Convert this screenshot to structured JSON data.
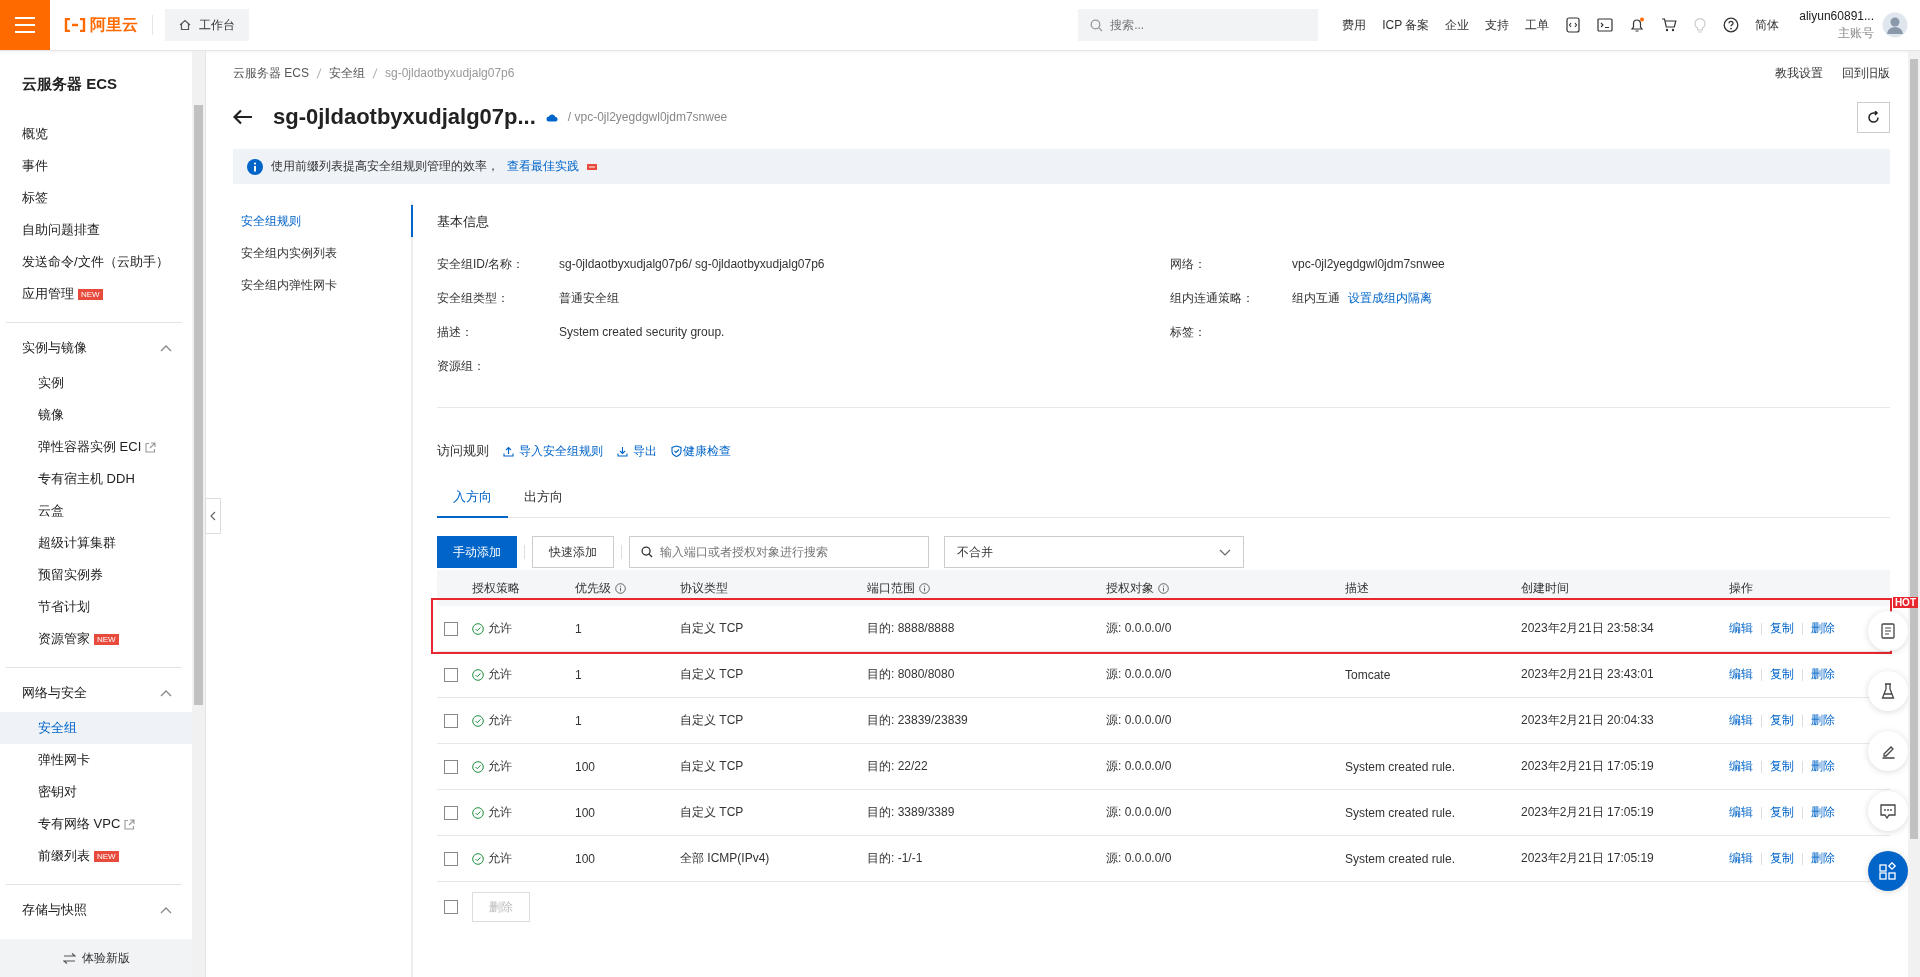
{
  "topbar": {
    "logo": "阿里云",
    "workbench": "工作台",
    "search_placeholder": "搜索...",
    "links": [
      "费用",
      "ICP 备案",
      "企业",
      "支持",
      "工单"
    ],
    "language": "简体",
    "user": {
      "name": "aliyun60891...",
      "role": "主账号"
    }
  },
  "sidebar": {
    "title": "云服务器 ECS",
    "groups": [
      {
        "items": [
          {
            "label": "概览",
            "selected": false
          },
          {
            "label": "事件",
            "selected": false
          },
          {
            "label": "标签",
            "selected": false
          },
          {
            "label": "自助问题排查",
            "selected": false
          },
          {
            "label": "发送命令/文件（云助手）",
            "selected": false
          },
          {
            "label": "应用管理",
            "badge": "NEW",
            "selected": false
          }
        ]
      },
      {
        "title": "实例与镜像",
        "expanded": true,
        "items": [
          {
            "label": "实例",
            "selected": false
          },
          {
            "label": "镜像",
            "selected": false
          },
          {
            "label": "弹性容器实例 ECI",
            "external": true,
            "selected": false
          },
          {
            "label": "专有宿主机 DDH",
            "selected": false
          },
          {
            "label": "云盒",
            "selected": false
          },
          {
            "label": "超级计算集群",
            "selected": false
          },
          {
            "label": "预留实例券",
            "selected": false
          },
          {
            "label": "节省计划",
            "selected": false
          },
          {
            "label": "资源管家",
            "badge": "NEW",
            "selected": false
          }
        ]
      },
      {
        "title": "网络与安全",
        "expanded": true,
        "items": [
          {
            "label": "安全组",
            "selected": true
          },
          {
            "label": "弹性网卡",
            "selected": false
          },
          {
            "label": "密钥对",
            "selected": false
          },
          {
            "label": "专有网络 VPC",
            "external": true,
            "selected": false
          },
          {
            "label": "前缀列表",
            "badge": "NEW",
            "selected": false
          }
        ]
      },
      {
        "title": "存储与快照",
        "expanded": true
      }
    ],
    "footer": "体验新版"
  },
  "breadcrumb": [
    "云服务器 ECS",
    "安全组",
    "sg-0jldaotbyxudjalg07p6"
  ],
  "header": {
    "title": "sg-0jldaotbyxudjalg07p...",
    "vpc": "/ vpc-0jl2yegdgwl0jdm7snwee",
    "links": [
      "教我设置",
      "回到旧版"
    ]
  },
  "banner": {
    "text": "使用前缀列表提高安全组规则管理的效率，",
    "link": "查看最佳实践"
  },
  "subnav": [
    {
      "label": "安全组规则",
      "selected": true
    },
    {
      "label": "安全组内实例列表",
      "selected": false
    },
    {
      "label": "安全组内弹性网卡",
      "selected": false
    }
  ],
  "basic_info": {
    "title": "基本信息",
    "left": [
      {
        "label": "安全组ID/名称：",
        "value": "sg-0jldaotbyxudjalg07p6/ sg-0jldaotbyxudjalg07p6"
      },
      {
        "label": "安全组类型：",
        "value": "普通安全组"
      },
      {
        "label": "描述：",
        "value": "System created security group."
      },
      {
        "label": "资源组："
      }
    ],
    "right": [
      {
        "label": "网络：",
        "value": "vpc-0jl2yegdgwl0jdm7snwee"
      },
      {
        "label": "组内连通策略：",
        "value": "组内互通",
        "link": "设置成组内隔离"
      },
      {
        "label": "标签："
      }
    ]
  },
  "rules": {
    "title": "访问规则",
    "actions": [
      {
        "kind": "upload",
        "label": "导入安全组规则"
      },
      {
        "kind": "download",
        "label": "导出"
      },
      {
        "kind": "shield",
        "label": "健康检查"
      }
    ],
    "tabs": [
      {
        "label": "入方向",
        "selected": true
      },
      {
        "label": "出方向",
        "selected": false
      }
    ],
    "add_button": "手动添加",
    "quick_add_button": "快速添加",
    "search_placeholder": "输入端口或者授权对象进行搜索",
    "merge_select": "不合并",
    "columns": [
      {
        "label": "授权策略",
        "info": false
      },
      {
        "label": "优先级",
        "info": true
      },
      {
        "label": "协议类型",
        "info": false
      },
      {
        "label": "端口范围",
        "info": true
      },
      {
        "label": "授权对象",
        "info": true
      },
      {
        "label": "描述",
        "info": false
      },
      {
        "label": "创建时间",
        "info": false
      },
      {
        "label": "操作",
        "info": false
      }
    ],
    "rows": [
      {
        "checked": false,
        "highlighted": true,
        "policy": "允许",
        "priority": "1",
        "protocol": "自定义 TCP",
        "port": "目的: 8888/8888",
        "source": "源: 0.0.0.0/0",
        "created": "2023年2月21日 23:58:34",
        "actions": [
          "编辑",
          "复制",
          "删除"
        ]
      },
      {
        "checked": false,
        "highlighted": false,
        "policy": "允许",
        "priority": "1",
        "protocol": "自定义 TCP",
        "port": "目的: 8080/8080",
        "source": "源: 0.0.0.0/0",
        "description": "Tomcate",
        "created": "2023年2月21日 23:43:01",
        "actions": [
          "编辑",
          "复制",
          "删除"
        ]
      },
      {
        "checked": false,
        "highlighted": false,
        "policy": "允许",
        "priority": "1",
        "protocol": "自定义 TCP",
        "port": "目的: 23839/23839",
        "source": "源: 0.0.0.0/0",
        "created": "2023年2月21日 20:04:33",
        "actions": [
          "编辑",
          "复制",
          "删除"
        ]
      },
      {
        "checked": false,
        "highlighted": false,
        "policy": "允许",
        "priority": "100",
        "protocol": "自定义 TCP",
        "port": "目的: 22/22",
        "source": "源: 0.0.0.0/0",
        "description": "System created rule.",
        "created": "2023年2月21日 17:05:19",
        "actions": [
          "编辑",
          "复制",
          "删除"
        ]
      },
      {
        "checked": false,
        "highlighted": false,
        "policy": "允许",
        "priority": "100",
        "protocol": "自定义 TCP",
        "port": "目的: 3389/3389",
        "source": "源: 0.0.0.0/0",
        "description": "System created rule.",
        "created": "2023年2月21日 17:05:19",
        "actions": [
          "编辑",
          "复制",
          "删除"
        ]
      },
      {
        "checked": false,
        "highlighted": false,
        "policy": "允许",
        "priority": "100",
        "protocol": "全部 ICMP(IPv4)",
        "port": "目的: -1/-1",
        "source": "源: 0.0.0.0/0",
        "description": "System created rule.",
        "created": "2023年2月21日 17:05:19",
        "actions": [
          "编辑",
          "复制",
          "删除"
        ]
      }
    ],
    "footer": {
      "checked": false,
      "delete_button": "删除",
      "disabled": true
    }
  },
  "float_badge": "HOT"
}
